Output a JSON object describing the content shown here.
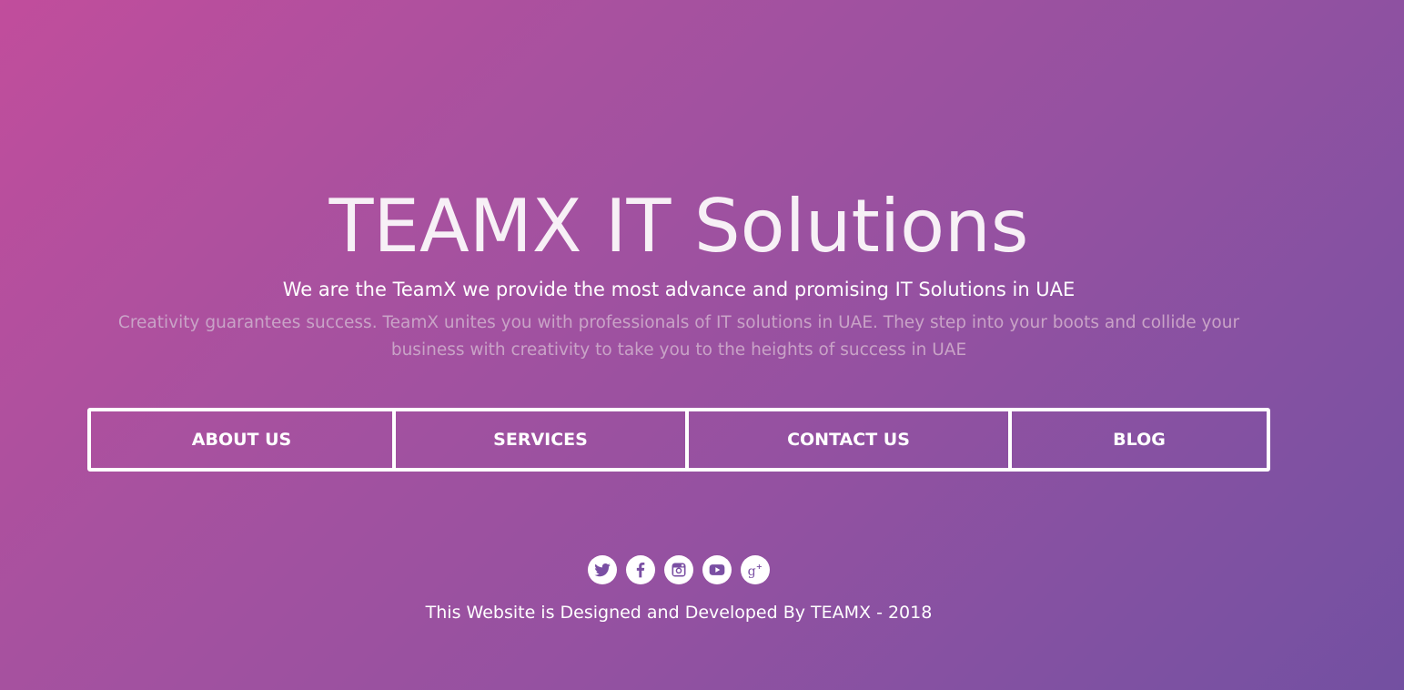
{
  "hero": {
    "title": "TEAMX IT Solutions",
    "subtitle": "We are the TeamX we provide the most advance and promising IT Solutions in UAE",
    "description": "Creativity guarantees success. TeamX unites you with professionals of IT solutions in UAE. They step into your boots and collide your business with creativity to take you to the heights of success in UAE"
  },
  "nav": {
    "items": [
      {
        "label": "ABOUT US"
      },
      {
        "label": "SERVICES"
      },
      {
        "label": "CONTACT US"
      },
      {
        "label": "BLOG"
      }
    ]
  },
  "social": {
    "icons": [
      "twitter-icon",
      "facebook-icon",
      "instagram-icon",
      "youtube-icon",
      "google-plus-icon"
    ],
    "icon_color": "#7a4fa3"
  },
  "footer": {
    "text": "This Website is Designed and Developed By TEAMX - 2018"
  },
  "colors": {
    "gradient_start": "#c14d9c",
    "gradient_end": "#7350a1",
    "description_text": "#c9a3c7"
  }
}
